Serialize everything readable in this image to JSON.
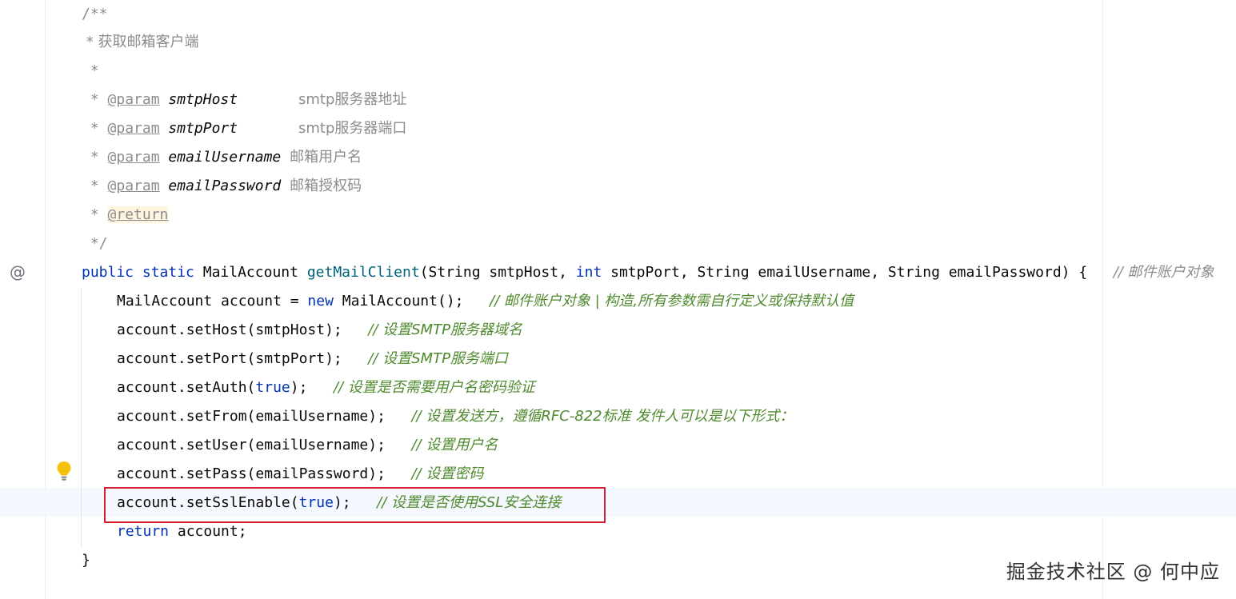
{
  "javadoc": {
    "open": "/**",
    "summary": " * 获取邮箱客户端",
    "blank": " *",
    "star": " * ",
    "params": [
      {
        "tag": "@param",
        "name": "smtpHost",
        "pad": "      ",
        "desc": "smtp服务器地址"
      },
      {
        "tag": "@param",
        "name": "smtpPort",
        "pad": "      ",
        "desc": "smtp服务器端口"
      },
      {
        "tag": "@param",
        "name": "emailUsername",
        "pad": " ",
        "desc": "邮箱用户名"
      },
      {
        "tag": "@param",
        "name": "emailPassword",
        "pad": " ",
        "desc": "邮箱授权码"
      }
    ],
    "return_tag": "@return",
    "close": " */"
  },
  "signature": {
    "public": "public",
    "static": "static",
    "return_type": "MailAccount",
    "method": "getMailClient",
    "params_1": "(String smtpHost, ",
    "int": "int",
    "params_2": " smtpPort, String emailUsername, String emailPassword) {",
    "comment": "// 邮件账户对象"
  },
  "body": [
    {
      "code_a": "MailAccount account = ",
      "kw": "new",
      "code_b": " MailAccount();",
      "comment": "// 邮件账户对象 | 构造,所有参数需自行定义或保持默认值"
    },
    {
      "code_a": "account.setHost(smtpHost);",
      "kw": "",
      "code_b": "",
      "comment": "// 设置SMTP服务器域名"
    },
    {
      "code_a": "account.setPort(smtpPort);",
      "kw": "",
      "code_b": "",
      "comment": "// 设置SMTP服务端口"
    },
    {
      "code_a": "account.setAuth(",
      "kw": "true",
      "code_b": ");",
      "comment": "// 设置是否需要用户名密码验证"
    },
    {
      "code_a": "account.setFrom(emailUsername);",
      "kw": "",
      "code_b": "",
      "comment": "// 设置发送方，遵循RFC-822标准 发件人可以是以下形式："
    },
    {
      "code_a": "account.setUser(emailUsername);",
      "kw": "",
      "code_b": "",
      "comment": "// 设置用户名"
    },
    {
      "code_a": "account.setPass(emailPassword);",
      "kw": "",
      "code_b": "",
      "comment": "// 设置密码"
    },
    {
      "code_a": "account.setSslEnable(",
      "kw": "true",
      "code_b": ");",
      "comment": "// 设置是否使用SSL安全连接"
    }
  ],
  "return_line": {
    "kw": "return",
    "code": " account;"
  },
  "closing_brace": "}",
  "icons": {
    "gutter_annotation": "at-sign-icon",
    "intention": "lightbulb-icon"
  },
  "colors": {
    "keyword": "#0033b3",
    "method": "#00627a",
    "comment": "#8c8c8c",
    "highlight_border": "#d6202f",
    "caret_row": "#f5f8fe"
  },
  "watermark": "掘金技术社区 @ 何中应"
}
